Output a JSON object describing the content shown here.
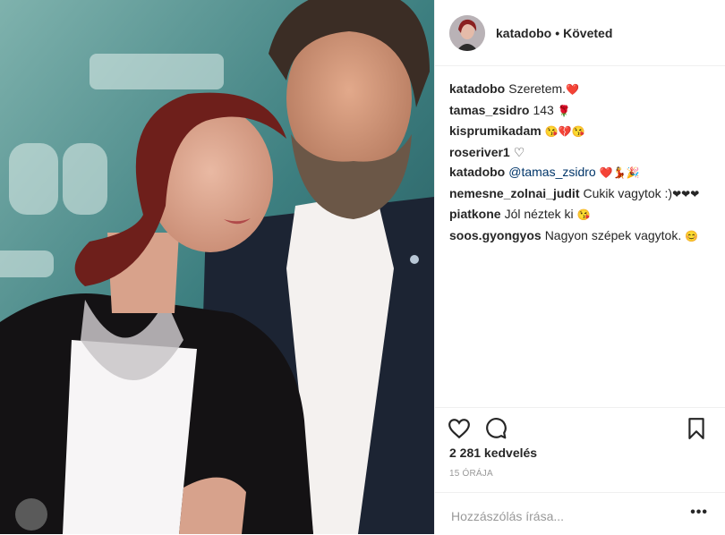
{
  "post": {
    "username": "katadobo",
    "separator": "•",
    "follow_status": "Követed"
  },
  "comments": [
    {
      "user": "katadobo",
      "text": "Szeretem.",
      "emoji": "❤️"
    },
    {
      "user": "tamas_zsidro",
      "text": "143",
      "emoji": "🌹"
    },
    {
      "user": "kisprumikadam",
      "text": "",
      "emoji": "😘💔😘"
    },
    {
      "user": "roseriver1",
      "text": "",
      "emoji": "♡"
    },
    {
      "user": "katadobo",
      "mention": "@tamas_zsidro",
      "text": "",
      "emoji": "❤️💃🎉"
    },
    {
      "user": "nemesne_zolnai_judit",
      "text": "Cukik vagytok :)",
      "emoji": "❤❤❤"
    },
    {
      "user": "piatkone",
      "text": "Jól néztek ki",
      "emoji": "😘"
    },
    {
      "user": "soos.gyongyos",
      "text": "Nagyon szépek vagytok.",
      "emoji": "😊"
    }
  ],
  "actions": {
    "like_icon": "heart-icon",
    "comment_icon": "comment-icon",
    "save_icon": "bookmark-icon"
  },
  "likes_text": "2 281 kedvelés",
  "time_text": "15 ÓRÁJA",
  "comment_placeholder": "Hozzászólás írása...",
  "more_label": "•••",
  "colors": {
    "text": "#262626",
    "muted": "#999999",
    "border": "#efefef",
    "mention": "#003569"
  }
}
